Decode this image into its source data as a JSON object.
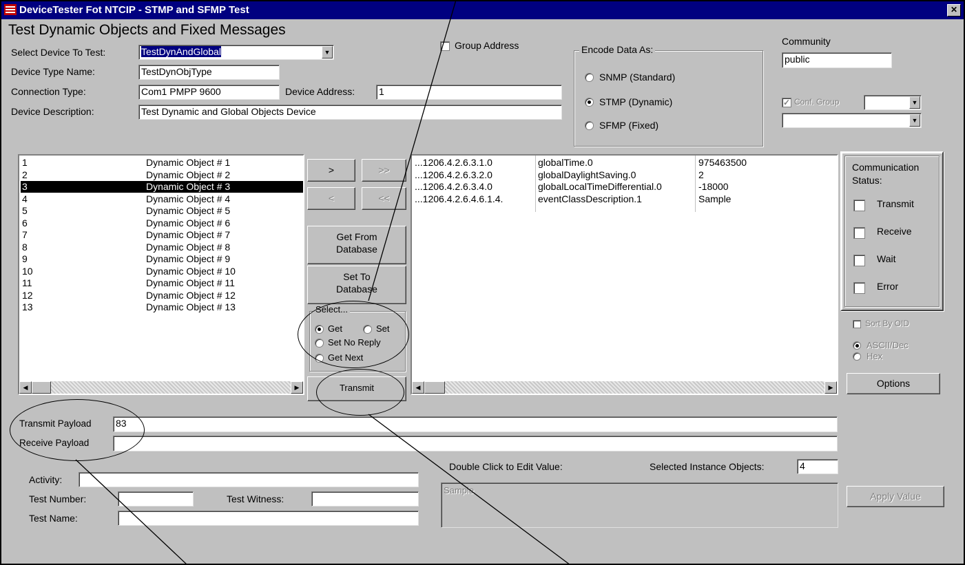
{
  "window": {
    "title": "DeviceTester Fot NTCIP - STMP and SFMP Test",
    "close_glyph": "✕"
  },
  "page_title": "Test Dynamic Objects and Fixed Messages",
  "device": {
    "select_label": "Select Device To Test:",
    "select_value": "TestDynAndGlobal",
    "type_label": "Device Type Name:",
    "type_value": "TestDynObjType",
    "connection_label": "Connection Type:",
    "connection_value": "Com1 PMPP 9600",
    "address_label": "Device Address:",
    "address_value": "1",
    "description_label": "Device Description:",
    "description_value": "Test Dynamic and Global Objects Device",
    "group_address_label": "Group Address"
  },
  "encode": {
    "title": "Encode Data As:",
    "options": [
      "SNMP (Standard)",
      "STMP (Dynamic)",
      "SFMP (Fixed)"
    ],
    "selected": "STMP (Dynamic)"
  },
  "community": {
    "label": "Community",
    "value": "public",
    "conf_group_label": "Conf. Group"
  },
  "objects_list": [
    {
      "num": "1",
      "name": "Dynamic Object # 1"
    },
    {
      "num": "2",
      "name": "Dynamic Object # 2"
    },
    {
      "num": "3",
      "name": "Dynamic Object # 3"
    },
    {
      "num": "4",
      "name": "Dynamic Object # 4"
    },
    {
      "num": "5",
      "name": "Dynamic Object # 5"
    },
    {
      "num": "6",
      "name": "Dynamic Object # 6"
    },
    {
      "num": "7",
      "name": "Dynamic Object # 7"
    },
    {
      "num": "8",
      "name": "Dynamic Object # 8"
    },
    {
      "num": "9",
      "name": "Dynamic Object # 9"
    },
    {
      "num": "10",
      "name": "Dynamic Object # 10"
    },
    {
      "num": "11",
      "name": "Dynamic Object # 11"
    },
    {
      "num": "12",
      "name": "Dynamic Object # 12"
    },
    {
      "num": "13",
      "name": "Dynamic Object # 13"
    }
  ],
  "selected_object": "3",
  "middle_buttons": {
    "add": ">",
    "add_all": ">>",
    "remove": "<",
    "remove_all": "<<",
    "get_from_db_1": "Get From",
    "get_from_db_2": "Database",
    "set_to_db_1": "Set To",
    "set_to_db_2": "Database",
    "select_title": "Select...",
    "get": "Get",
    "set": "Set",
    "set_no_reply": "Set No Reply",
    "get_next": "Get Next",
    "transmit": "Transmit"
  },
  "instance_list": [
    {
      "oid": "...1206.4.2.6.3.1.0",
      "name": "globalTime.0",
      "value": "975463500"
    },
    {
      "oid": "...1206.4.2.6.3.2.0",
      "name": "globalDaylightSaving.0",
      "value": "2"
    },
    {
      "oid": "...1206.4.2.6.3.4.0",
      "name": "globalLocalTimeDifferential.0",
      "value": "-18000"
    },
    {
      "oid": "...1206.4.2.6.4.6.1.4.",
      "name": "eventClassDescription.1",
      "value": "Sample"
    }
  ],
  "comm_status": {
    "title_1": "Communication",
    "title_2": "Status:",
    "transmit": "Transmit",
    "receive": "Receive",
    "wait": "Wait",
    "error": "Error"
  },
  "display_opts": {
    "sort_by_oid": "Sort By OID",
    "ascii": "ASCII/Dec",
    "hex": "Hex",
    "options_button": "Options"
  },
  "payload": {
    "transmit_label": "Transmit Payload",
    "transmit_value": "83",
    "receive_label": "Receive Payload",
    "receive_value": ""
  },
  "test": {
    "activity_label": "Activity:",
    "activity_value": "",
    "number_label": "Test Number:",
    "number_value": "",
    "witness_label": "Test Witness:",
    "witness_value": "",
    "name_label": "Test Name:",
    "name_value": ""
  },
  "edit": {
    "double_click_label": "Double Click to Edit Value:",
    "selected_instances_label": "Selected Instance Objects:",
    "selected_instances_value": "4",
    "value_text": "Sample",
    "apply_button": "Apply Value"
  }
}
